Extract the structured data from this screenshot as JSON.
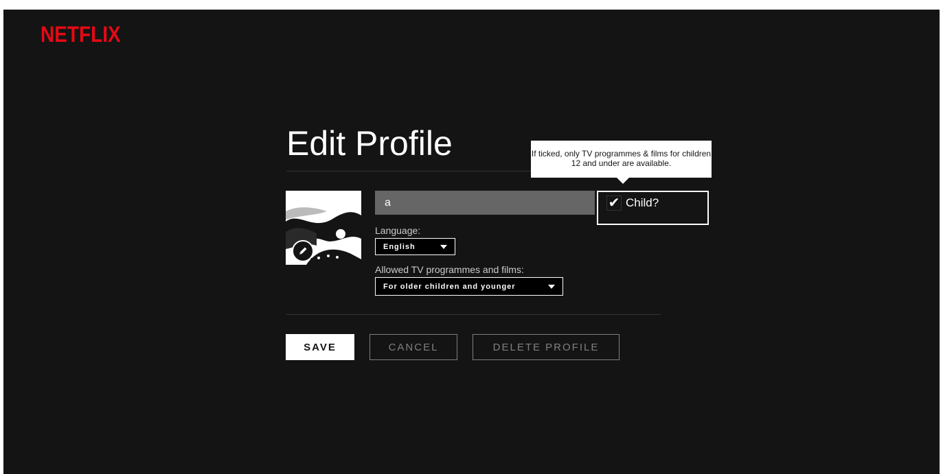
{
  "brand": {
    "logo_text": "NETFLIX",
    "color": "#e50914"
  },
  "page": {
    "title": "Edit Profile",
    "background": "#141414"
  },
  "profile": {
    "avatar_icon": "avatar-abstract-landscape",
    "edit_icon": "pencil-icon",
    "name_value": "a"
  },
  "child_toggle": {
    "label": "Child?",
    "checked": true,
    "tooltip": "If ticked, only TV programmes & films for children 12 and under are available."
  },
  "language": {
    "label": "Language:",
    "selected": "English"
  },
  "maturity": {
    "label": "Allowed TV programmes and films:",
    "selected": "For older children and younger"
  },
  "actions": {
    "save": "SAVE",
    "cancel": "CANCEL",
    "delete": "DELETE PROFILE"
  }
}
